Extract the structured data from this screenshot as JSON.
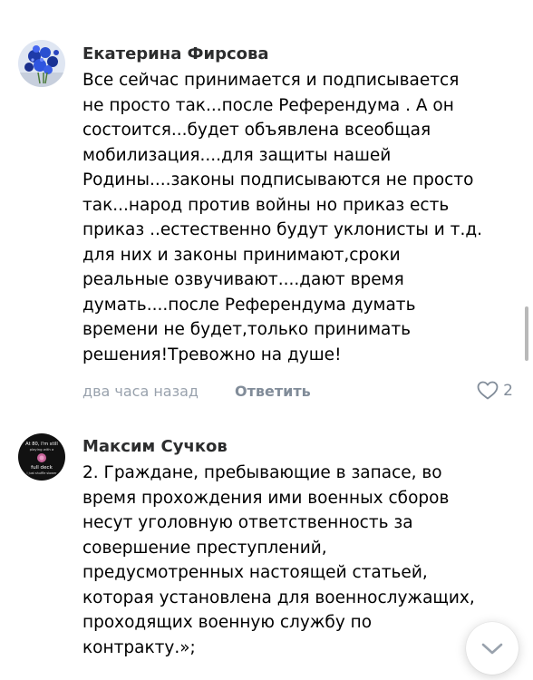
{
  "comments": [
    {
      "author": "Екатерина Фирсова",
      "lines": [
        "Все сейчас принимается и подписывается",
        "не просто так...после Референдума . А он",
        "состоится...будет объявлена всеобщая",
        "мобилизация....для защиты нашей",
        "Родины....законы подписываются не просто",
        "так...народ против войны но приказ есть",
        "приказ ..естественно будут уклонисты и т.д.",
        "для них и законы принимают,сроки",
        "реальные озвучивают....дают время",
        "думать....после Референдума думать",
        "времени не будет,только принимать",
        "решения!Тревожно на душе!"
      ],
      "time": "два часа назад",
      "reply_label": "Ответить",
      "likes": "2",
      "avatar_icon": "flower-bouquet-avatar"
    },
    {
      "author": "Максим Сучков",
      "lines": [
        "2. Граждане, пребывающие в запасе, во",
        "время прохождения ими военных сборов",
        "несут уголовную ответственность за",
        "совершение преступлений,",
        "предусмотренных настоящей статьей,",
        "которая установлена для военнослужащих,",
        "проходящих военную службу по",
        "контракту.»;"
      ],
      "avatar_icon": "dark-circle-avatar",
      "avatar_text": {
        "line1": "At 80, I'm still",
        "line2": "playing with a",
        "line3": "full deck",
        "line4": "I just shuffle slower"
      }
    }
  ],
  "colors": {
    "meta": "#99a2ad",
    "reply": "#818c99",
    "author": "#2c2d2e"
  }
}
